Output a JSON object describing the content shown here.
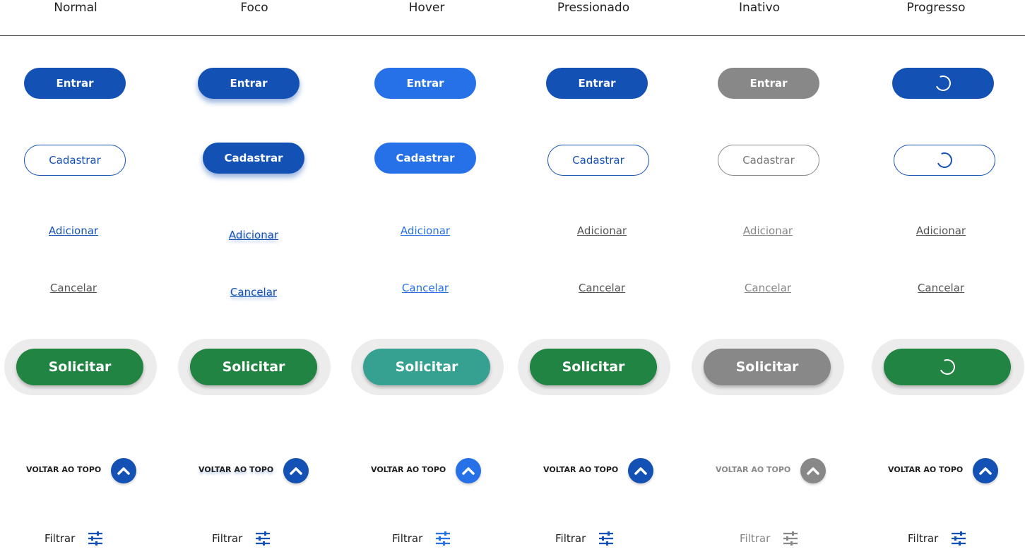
{
  "headers": [
    "Normal",
    "Foco",
    "Hover",
    "Pressionado",
    "Inativo",
    "Progresso"
  ],
  "primary_label": "Entrar",
  "secondary_label": "Cadastrar",
  "link_add": "Adicionar",
  "link_cancel": "Cancelar",
  "request_label": "Solicitar",
  "back_to_top": "VOLTAR AO TOPO",
  "filter_label": "Filtrar",
  "colors": {
    "primary": "#1351b4",
    "hover": "#2670e8",
    "success": "#228442",
    "success_hover": "#36a191",
    "disabled": "#888888"
  },
  "icons": {
    "back_to_top": "chevron-up-icon",
    "filter": "sliders-icon",
    "progress": "spinner-icon"
  }
}
